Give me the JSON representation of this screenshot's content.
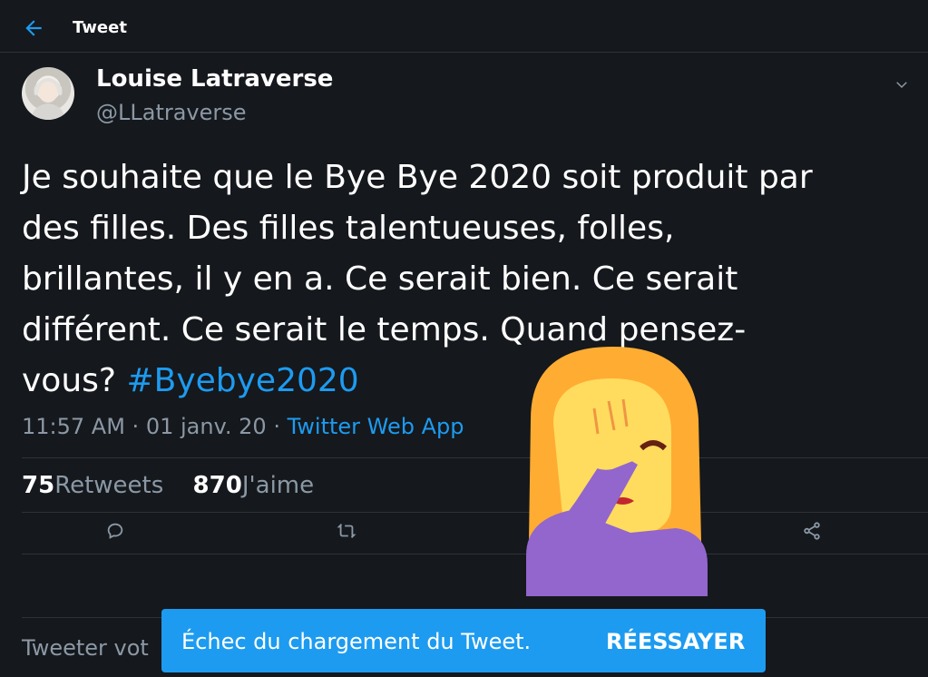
{
  "header": {
    "title": "Tweet",
    "back_icon": "arrow-left-icon"
  },
  "author": {
    "name": "Louise Latraverse",
    "handle": "@LLatraverse"
  },
  "tweet": {
    "text_part1": "Je souhaite que le Bye Bye 2020 soit produit par des filles. Des filles talentueuses, folles, brillantes, il y en a.  Ce serait bien. Ce serait différent. Ce serait le temps. Quand pensez-vous? ",
    "hashtag": "#Byebye2020",
    "time": "11:57 AM",
    "date": "01 janv. 20",
    "separator": " · ",
    "source": "Twitter Web App"
  },
  "stats": {
    "retweets_count": "75",
    "retweets_label": "Retweets",
    "likes_count": "870",
    "likes_label": "J'aime"
  },
  "actions": [
    "reply-icon",
    "retweet-icon",
    "like-icon",
    "share-icon"
  ],
  "compose": {
    "placeholder": "Tweeter vot"
  },
  "toast": {
    "message": "Échec du chargement du Tweet.",
    "retry": "RÉESSAYER"
  },
  "colors": {
    "background": "#15181c",
    "accent": "#1d9bf0",
    "secondary_text": "#8b98a5",
    "border": "#2f3336"
  },
  "overlay": {
    "emoji": "face-palm-emoji"
  }
}
